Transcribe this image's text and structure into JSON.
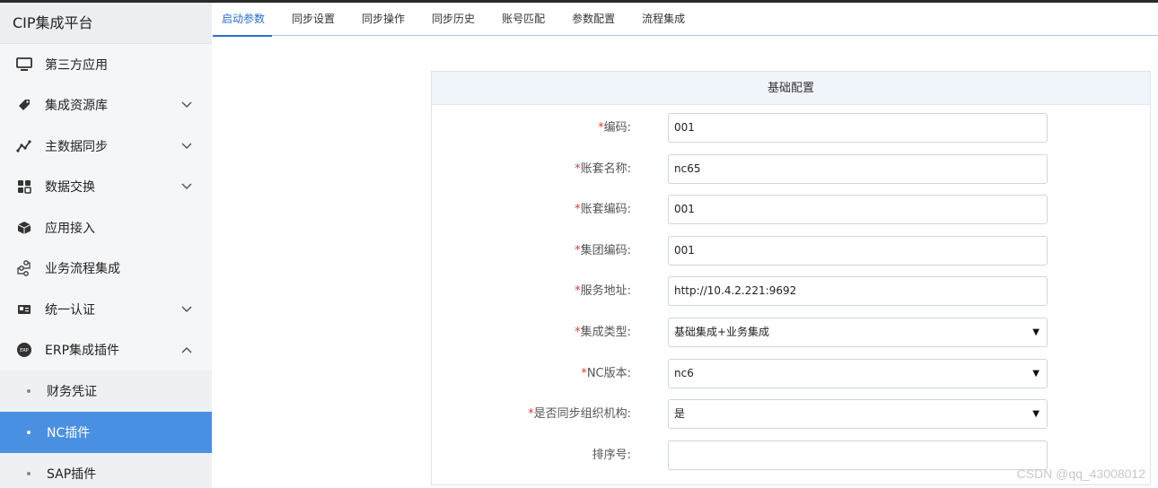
{
  "app": {
    "title": "CIP集成平台"
  },
  "sidebar": {
    "items": [
      {
        "label": "第三方应用",
        "icon": "monitor-icon",
        "chevron": ""
      },
      {
        "label": "集成资源库",
        "icon": "tag-icon",
        "chevron": "down"
      },
      {
        "label": "主数据同步",
        "icon": "line-graph-icon",
        "chevron": "down"
      },
      {
        "label": "数据交换",
        "icon": "exchange-icon",
        "chevron": "down"
      },
      {
        "label": "应用接入",
        "icon": "cube-icon",
        "chevron": ""
      },
      {
        "label": "业务流程集成",
        "icon": "flow-icon",
        "chevron": ""
      },
      {
        "label": "统一认证",
        "icon": "id-card-icon",
        "chevron": "down"
      },
      {
        "label": "ERP集成插件",
        "icon": "erp-icon",
        "chevron": "up"
      }
    ],
    "sub_items": [
      {
        "label": "财务凭证",
        "active": false
      },
      {
        "label": "NC插件",
        "active": true
      },
      {
        "label": "SAP插件",
        "active": false
      }
    ]
  },
  "tabs": [
    {
      "label": "启动参数",
      "active": true
    },
    {
      "label": "同步设置",
      "active": false
    },
    {
      "label": "同步操作",
      "active": false
    },
    {
      "label": "同步历史",
      "active": false
    },
    {
      "label": "账号匹配",
      "active": false
    },
    {
      "label": "参数配置",
      "active": false
    },
    {
      "label": "流程集成",
      "active": false
    }
  ],
  "panel": {
    "title": "基础配置",
    "fields": [
      {
        "label": "编码:",
        "required": true,
        "value": "001",
        "type": "text"
      },
      {
        "label": "账套名称:",
        "required": true,
        "value": "nc65",
        "type": "text"
      },
      {
        "label": "账套编码:",
        "required": true,
        "value": "001",
        "type": "text"
      },
      {
        "label": "集团编码:",
        "required": true,
        "value": "001",
        "type": "text"
      },
      {
        "label": "服务地址:",
        "required": true,
        "value": "http://10.4.2.221:9692",
        "type": "text"
      },
      {
        "label": "集成类型:",
        "required": true,
        "value": "基础集成+业务集成",
        "type": "select"
      },
      {
        "label": "NC版本:",
        "required": true,
        "value": "nc6",
        "type": "select"
      },
      {
        "label": "是否同步组织机构:",
        "required": true,
        "value": "是",
        "type": "select"
      },
      {
        "label": "排序号:",
        "required": false,
        "value": "",
        "type": "text"
      }
    ]
  },
  "watermark": "CSDN @qq_43008012",
  "colors": {
    "accent": "#4a90e2",
    "tab_active": "#2a6fd1",
    "required": "#e03a3a"
  }
}
